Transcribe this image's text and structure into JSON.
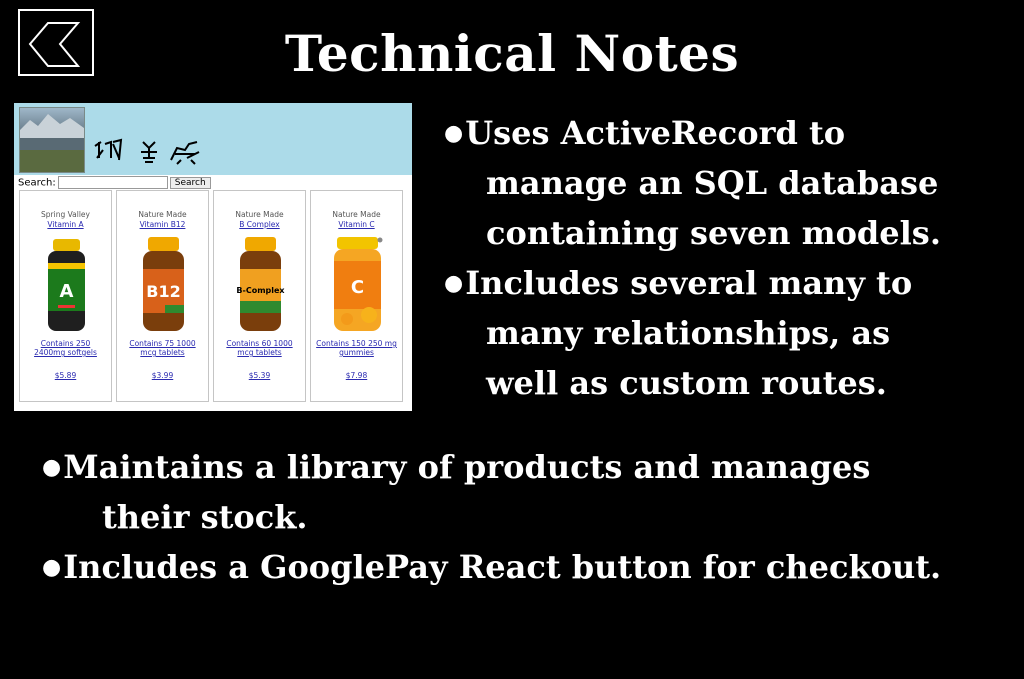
{
  "title": "Technical Notes",
  "bullets": [
    {
      "first": "Uses ActiveRecord to",
      "rest": [
        "manage an SQL database",
        "containing seven models."
      ]
    },
    {
      "first": "Includes several many to",
      "rest": [
        "many relationships, as",
        "well as custom routes."
      ]
    },
    {
      "first": "Maintains a library of products and manages",
      "rest": [
        "their stock."
      ]
    },
    {
      "first": "Includes a GooglePay React button for checkout.",
      "rest": []
    }
  ],
  "screenshot": {
    "search_label": "Search:",
    "search_button": "Search",
    "products": [
      {
        "brand": "Spring Valley",
        "name": "Vitamin A",
        "description": "Contains 250 2400mg softgels",
        "price": "$5.89",
        "cap_color": "#e8b800",
        "label_color": "#1c7a1c",
        "letter": "A"
      },
      {
        "brand": "Nature Made",
        "name": "Vitamin B12",
        "description": "Contains 75 1000 mcg tablets",
        "price": "$3.99",
        "cap_color": "#f0a800",
        "label_color": "#d8611a",
        "letter": "B12"
      },
      {
        "brand": "Nature Made",
        "name": "B Complex",
        "description": "Contains 60 1000 mcg tablets",
        "price": "$5.39",
        "cap_color": "#f0a800",
        "label_color": "#2f8a2f",
        "letter": "B"
      },
      {
        "brand": "Nature Made",
        "name": "Vitamin C",
        "description": "Contains 150 250 mg gummies",
        "price": "$7.98",
        "cap_color": "#f2c400",
        "label_color": "#f07e10",
        "letter": "C"
      }
    ]
  }
}
